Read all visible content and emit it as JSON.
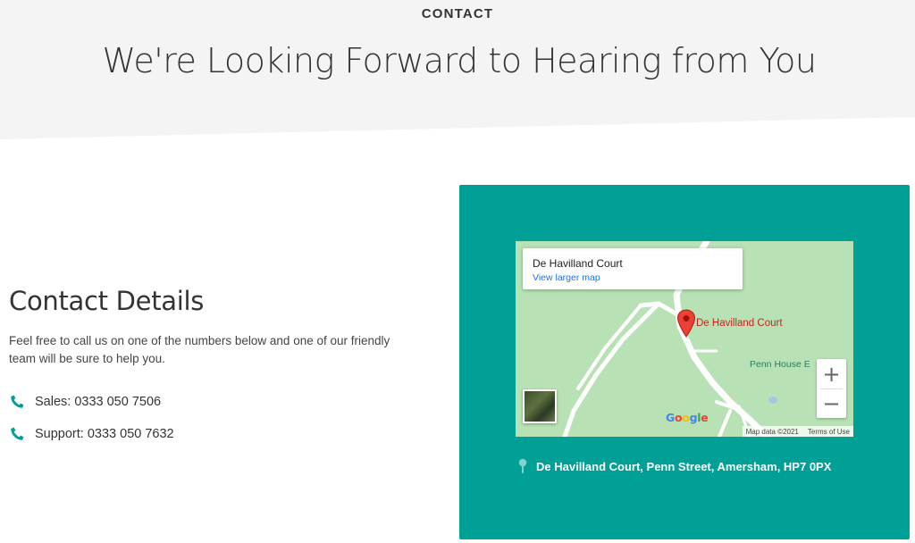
{
  "hero": {
    "label": "CONTACT",
    "title": "We're Looking Forward to Hearing from You"
  },
  "contact": {
    "heading": "Contact Details",
    "intro": "Feel free to call us on one of the numbers below and one of our friendly team will be sure to help you.",
    "phones": [
      {
        "icon": "phone-icon",
        "text": "Sales: 0333 050 7506"
      },
      {
        "icon": "phone-icon",
        "text": "Support: 0333 050 7632"
      }
    ]
  },
  "map": {
    "card_title": "De Havilland Court",
    "card_link": "View larger map",
    "pin_label": "De Havilland Court",
    "place_label": "Penn House E",
    "zoom_in": "+",
    "zoom_out": "−",
    "attribution": "Map data ©2021",
    "terms": "Terms of Use"
  },
  "address": {
    "icon": "map-pin-icon",
    "text": "De Havilland Court, Penn Street, Amersham, HP7 0PX"
  },
  "colors": {
    "hero_bg": "#f4f4f4",
    "accent": "#00a096",
    "map_land": "#b8e2b5",
    "pin": "#ea4335",
    "link": "#1a73e8"
  }
}
